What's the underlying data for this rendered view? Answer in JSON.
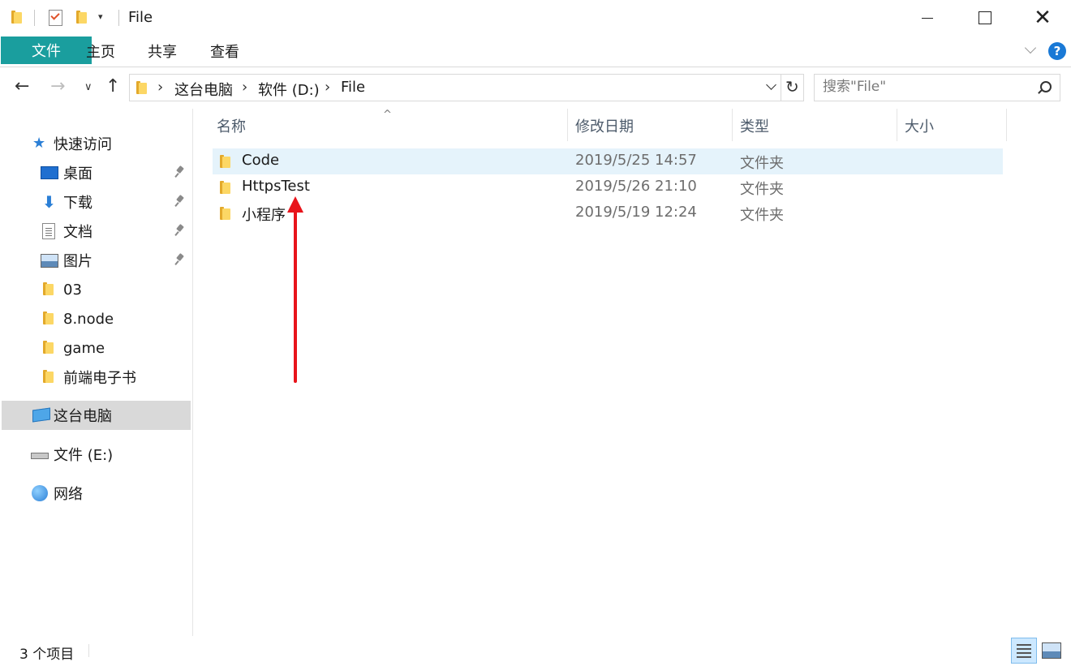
{
  "window": {
    "title": "File",
    "qat_dropdown": "▾",
    "minimize": "",
    "maximize": "",
    "close": "✕"
  },
  "ribbon": {
    "tabs": [
      "文件",
      "主页",
      "共享",
      "查看"
    ],
    "help": "?"
  },
  "navigation": {
    "back": "←",
    "forward": "→",
    "recent": "∨",
    "up": "↑",
    "breadcrumb": [
      "这台电脑",
      "软件 (D:)",
      "File"
    ],
    "separator": "›",
    "refresh": "↻"
  },
  "search": {
    "placeholder": "搜索\"File\""
  },
  "sidebar": {
    "quick_access": "快速访问",
    "items": [
      {
        "label": "桌面",
        "icon": "desktop-icon",
        "pinned": true
      },
      {
        "label": "下载",
        "icon": "download-icon",
        "pinned": true
      },
      {
        "label": "文档",
        "icon": "document-icon",
        "pinned": true
      },
      {
        "label": "图片",
        "icon": "pictures-icon",
        "pinned": true
      },
      {
        "label": "03",
        "icon": "folder-icon",
        "pinned": false
      },
      {
        "label": "8.node",
        "icon": "folder-icon",
        "pinned": false
      },
      {
        "label": "game",
        "icon": "folder-icon",
        "pinned": false
      },
      {
        "label": "前端电子书",
        "icon": "folder-icon",
        "pinned": false
      }
    ],
    "this_pc": "这台电脑",
    "drive_e": "文件 (E:)",
    "network": "网络"
  },
  "file_list": {
    "columns": [
      "名称",
      "修改日期",
      "类型",
      "大小"
    ],
    "sort_indicator": "^",
    "rows": [
      {
        "name": "Code",
        "date": "2019/5/25 14:57",
        "type": "文件夹",
        "size": "",
        "selected": true
      },
      {
        "name": "HttpsTest",
        "date": "2019/5/26 21:10",
        "type": "文件夹",
        "size": "",
        "selected": false
      },
      {
        "name": "小程序",
        "date": "2019/5/19 12:24",
        "type": "文件夹",
        "size": "",
        "selected": false
      }
    ]
  },
  "status": {
    "item_count": "3 个项目"
  },
  "colors": {
    "file_tab": "#1a9e9e",
    "selection": "#e5f3fb",
    "annotation_arrow": "#e8141b",
    "accent_blue": "#1979d6"
  }
}
